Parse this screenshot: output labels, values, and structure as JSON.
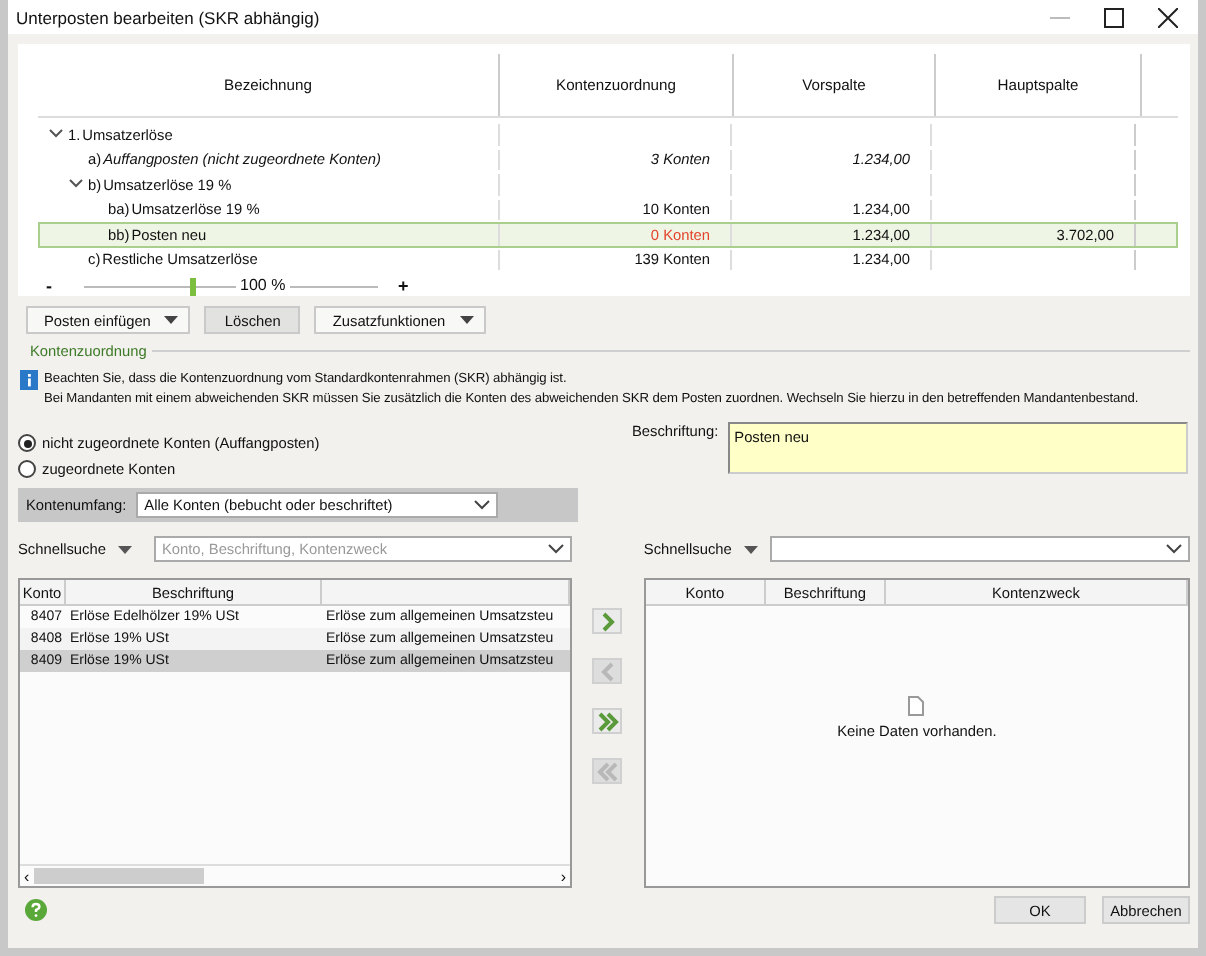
{
  "window": {
    "title": "Unterposten bearbeiten (SKR abhängig)"
  },
  "tree": {
    "columns": [
      "Bezeichnung",
      "Kontenzuordnung",
      "Vorspalte",
      "Hauptspalte"
    ],
    "rows": [
      {
        "prefix": "1.",
        "label": "Umsatzerlöse",
        "expanded": true,
        "selected": false,
        "children": [
          {
            "prefix": "a)",
            "label": "Auffangposten (nicht zugeordnete Konten)",
            "italic": true,
            "selected": false,
            "unassigned": false,
            "konten": "3 Konten",
            "vorspalte": "1.234,00"
          },
          {
            "prefix": "b)",
            "label": "Umsatzerlöse 19 %",
            "expanded": true,
            "selected": false,
            "children": [
              {
                "prefix": "ba)",
                "label": "Umsatzerlöse 19 %",
                "selected": false,
                "unassigned": false,
                "konten": "10 Konten",
                "vorspalte": "1.234,00"
              },
              {
                "prefix": "bb)",
                "label": "Posten neu",
                "selected": true,
                "unassigned": true,
                "konten": "0 Konten",
                "vorspalte": "1.234,00",
                "hauptspalte": "3.702,00"
              }
            ]
          },
          {
            "prefix": "c)",
            "label": "Restliche Umsatzerlöse",
            "selected": false,
            "unassigned": false,
            "konten": "139 Konten",
            "vorspalte": "1.234,00"
          }
        ]
      }
    ]
  },
  "zoom": {
    "minus": "-",
    "plus": "+",
    "reading": "100 %",
    "level": 0.37
  },
  "toolbar": [
    {
      "label": "Posten einfügen",
      "dropdown": true
    },
    {
      "label": "Löschen",
      "dropdown": false
    },
    {
      "label": "Zusatzfunktionen",
      "dropdown": true
    }
  ],
  "group_title": "Kontenzuordnung",
  "info": [
    "Beachten Sie, dass die Kontenzuordnung vom Standardkontenrahmen (SKR) abhängig ist.",
    "Bei Mandanten mit einem abweichenden SKR müssen Sie zusätzlich die Konten des abweichenden SKR dem Posten zuordnen. Wechseln Sie hierzu in den betreffenden Mandantenbestand."
  ],
  "radios": [
    {
      "label": "nicht zugeordnete Konten (Auffangposten)",
      "selected": true
    },
    {
      "label": "zugeordnete Konten",
      "selected": false
    }
  ],
  "beschriftung": {
    "label": "Beschriftung:",
    "value": "Posten neu"
  },
  "kontenumfang": {
    "label": "Kontenumfang:",
    "value": "Alle Konten (bebucht oder beschriftet)"
  },
  "left_search": {
    "label": "Schnellsuche",
    "placeholder": "Konto, Beschriftung, Kontenzweck"
  },
  "right_search": {
    "label": "Schnellsuche"
  },
  "scroll_arrows": {
    "left": "‹",
    "right": "›"
  },
  "left_table": {
    "columns": [
      "Konto",
      "Beschriftung"
    ],
    "rows": [
      {
        "konto": "8407",
        "beschriftung": "Erlöse Edelhölzer 19% USt",
        "column_3": "Erlöse zum allgemeinen Umsatzsteu",
        "selected": false
      },
      {
        "konto": "8408",
        "beschriftung": "Erlöse 19% USt",
        "column_3": "Erlöse zum allgemeinen Umsatzsteu",
        "selected": false
      },
      {
        "konto": "8409",
        "beschriftung": "Erlöse 19% USt",
        "column_3": "Erlöse zum allgemeinen Umsatzsteu",
        "selected": true
      }
    ]
  },
  "move_buttons": [
    {
      "kind": "right",
      "disabled": false
    },
    {
      "kind": "left",
      "disabled": true
    },
    {
      "kind": "all-right",
      "disabled": false
    },
    {
      "kind": "all-left",
      "disabled": true
    }
  ],
  "right_table": {
    "columns": [
      "Konto",
      "Beschriftung",
      "Kontenzweck"
    ],
    "empty": "Keine Daten vorhanden."
  },
  "buttons": [
    "OK",
    "Abbrechen"
  ]
}
